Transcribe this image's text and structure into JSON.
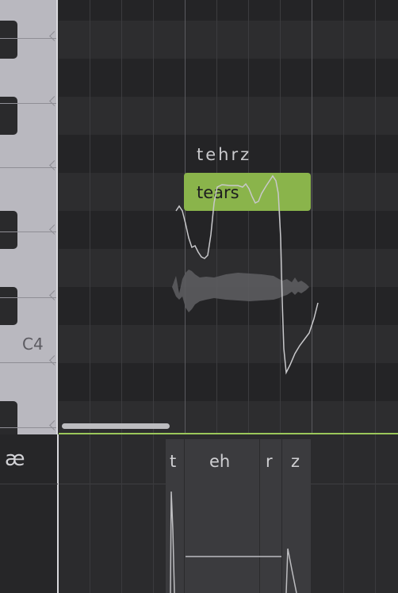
{
  "keyboard": {
    "octave_label": "C4"
  },
  "note": {
    "lyric": "tears",
    "phonemes_display": "tehrz"
  },
  "phoneme_panel": {
    "left_label": "æ",
    "phonemes": [
      {
        "label": "t"
      },
      {
        "label": "eh"
      },
      {
        "label": "r"
      },
      {
        "label": "z"
      }
    ]
  },
  "colors": {
    "note_fill": "#8ab44b",
    "divider": "#9bc75a",
    "grid_dark": "#242426",
    "grid_light": "#2d2d2f",
    "keyboard_white": "#b9b8bf",
    "keyboard_black": "#2a2a2c"
  }
}
